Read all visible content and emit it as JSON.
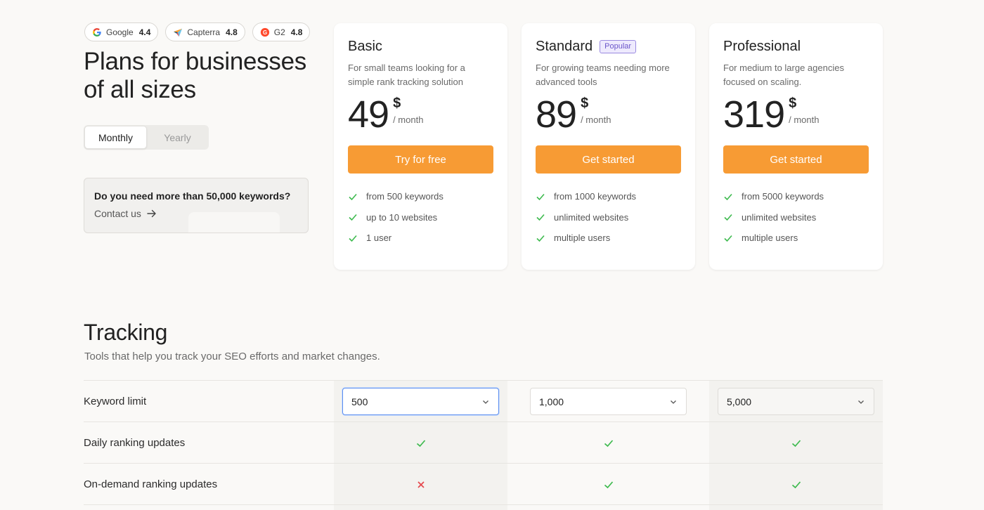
{
  "ratings": [
    {
      "name": "Google",
      "score": "4.4",
      "icon": "google-icon"
    },
    {
      "name": "Capterra",
      "score": "4.8",
      "icon": "capterra-icon"
    },
    {
      "name": "G2",
      "score": "4.8",
      "icon": "g2-icon"
    }
  ],
  "hero": {
    "title": "Plans for businesses of all sizes"
  },
  "billing": {
    "monthly": "Monthly",
    "yearly": "Yearly",
    "selected": "Monthly"
  },
  "more_box": {
    "title": "Do you need more than 50,000 keywords?",
    "link": "Contact us"
  },
  "plans": [
    {
      "name": "Basic",
      "badge": "",
      "description": "For small teams looking for a simple rank tracking solution",
      "price": "49",
      "currency": "$",
      "period": "/ month",
      "cta": "Try for free",
      "features": [
        "from 500 keywords",
        "up to 10 websites",
        "1 user"
      ]
    },
    {
      "name": "Standard",
      "badge": "Popular",
      "description": "For growing teams needing more advanced tools",
      "price": "89",
      "currency": "$",
      "period": "/ month",
      "cta": "Get started",
      "features": [
        "from 1000 keywords",
        "unlimited websites",
        "multiple users"
      ]
    },
    {
      "name": "Professional",
      "badge": "",
      "description": "For medium to large agencies focused on scaling.",
      "price": "319",
      "currency": "$",
      "period": "/ month",
      "cta": "Get started",
      "features": [
        "from 5000 keywords",
        "unlimited websites",
        "multiple users"
      ]
    }
  ],
  "tracking": {
    "title": "Tracking",
    "subtitle": "Tools that help you track your SEO efforts and market changes.",
    "rows": [
      {
        "label": "Keyword limit",
        "values": [
          "500",
          "1,000",
          "5,000"
        ]
      },
      {
        "label": "Daily ranking updates",
        "values": [
          "check",
          "check",
          "check"
        ]
      },
      {
        "label": "On-demand ranking updates",
        "values": [
          "cross",
          "check",
          "check"
        ]
      }
    ]
  },
  "colors": {
    "accent": "#f79b34",
    "check": "#3dba4e",
    "cross": "#e5484d",
    "badge": "#6b56c9"
  }
}
